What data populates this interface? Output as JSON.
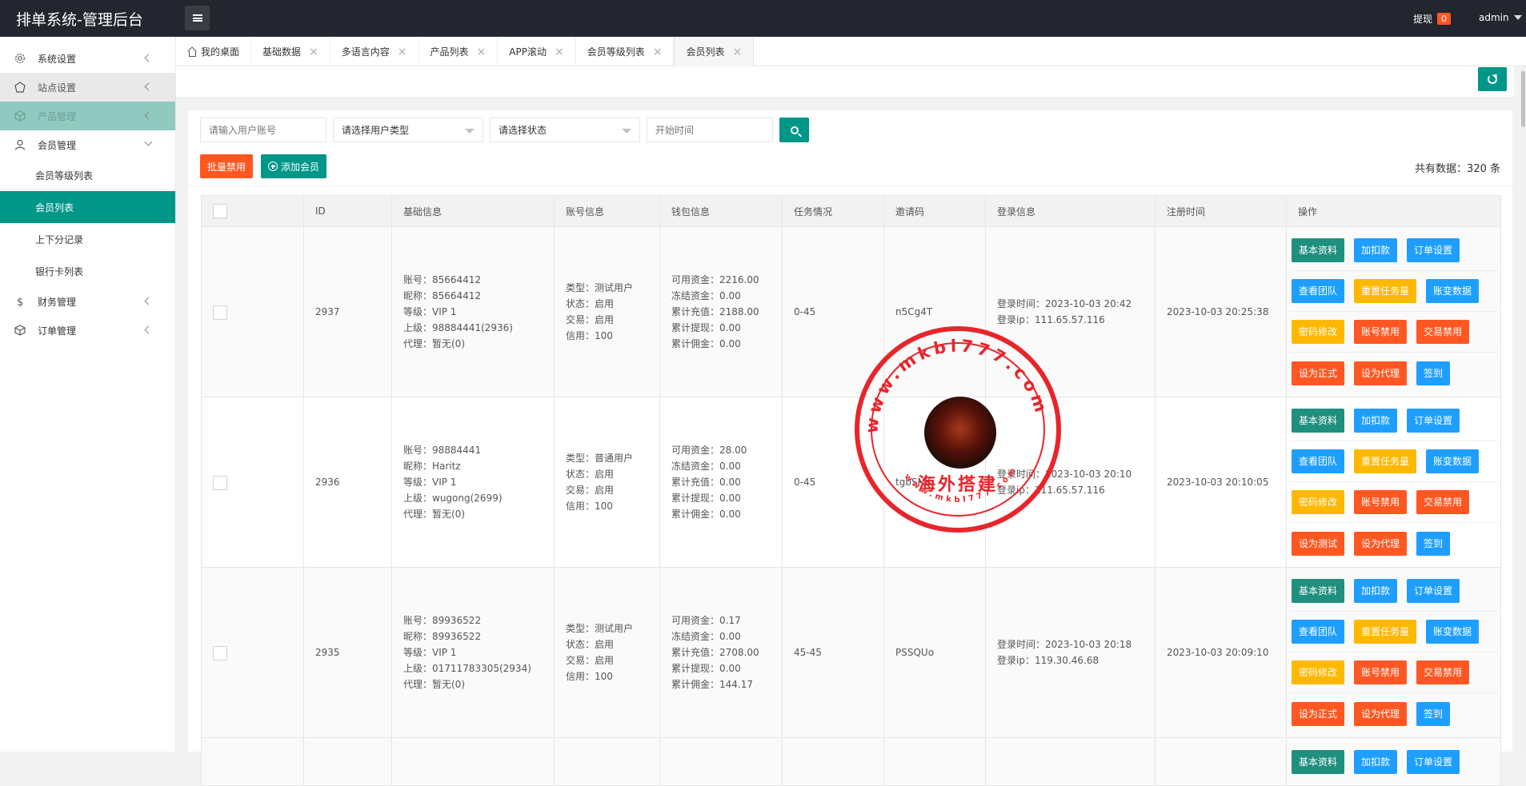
{
  "header": {
    "brand": "排单系统-管理后台",
    "withdraw_label": "提现",
    "withdraw_count": "0",
    "user": "admin"
  },
  "sidebar": {
    "items": [
      {
        "label": "系统设置",
        "icon": "gear-icon"
      },
      {
        "label": "站点设置",
        "icon": "site-icon"
      },
      {
        "label": "产品管理",
        "icon": "box-icon"
      },
      {
        "label": "会员管理",
        "icon": "user-icon"
      },
      {
        "label": "财务管理",
        "icon": "dollar-icon"
      },
      {
        "label": "订单管理",
        "icon": "orders-icon"
      }
    ],
    "sub_items": [
      "会员等级列表",
      "会员列表",
      "上下分记录",
      "银行卡列表"
    ]
  },
  "tabs": [
    {
      "label": "我的桌面"
    },
    {
      "label": "基础数据"
    },
    {
      "label": "多语言内容"
    },
    {
      "label": "产品列表"
    },
    {
      "label": "APP滚动"
    },
    {
      "label": "会员等级列表"
    },
    {
      "label": "会员列表"
    }
  ],
  "filters": {
    "account_placeholder": "请输入用户账号",
    "user_type": "请选择用户类型",
    "status": "请选择状态",
    "start_time_placeholder": "开始时间"
  },
  "actions": {
    "batch_disable": "批量禁用",
    "add_member": "添加会员",
    "total": "共有数据：320 条"
  },
  "table": {
    "columns": [
      "ID",
      "基础信息",
      "账号信息",
      "钱包信息",
      "任务情况",
      "邀请码",
      "登录信息",
      "注册时间",
      "操作"
    ],
    "rows": [
      {
        "id": "2937",
        "basic": [
          "账号：85664412",
          "昵称：85664412",
          "等级：VIP 1",
          "上级：98884441(2936)",
          "代理：暂无(0)"
        ],
        "account": [
          "类型：测试用户",
          "状态：启用",
          "交易：启用",
          "信用：100"
        ],
        "wallet": [
          "可用资金：2216.00",
          "冻结资金：0.00",
          "累计充值：2188.00",
          "累计提现：0.00",
          "累计佣金：0.00"
        ],
        "task": "0-45",
        "invite": "n5Cg4T",
        "login": [
          "登录时间：2023-10-03 20:42",
          "登录ip：111.65.57.116"
        ],
        "register": "2023-10-03 20:25:38",
        "ops": [
          [
            "基本资料",
            "加扣款",
            "订单设置"
          ],
          [
            "查看团队",
            "重置任务量",
            "账变数据"
          ],
          [
            "密码修改",
            "账号禁用",
            "交易禁用"
          ],
          [
            "设为正式",
            "设为代理",
            "签到"
          ]
        ]
      },
      {
        "id": "2936",
        "basic": [
          "账号：98884441",
          "昵称：Haritz",
          "等级：VIP 1",
          "上级：wugong(2699)",
          "代理：暂无(0)"
        ],
        "account": [
          "类型：普通用户",
          "状态：启用",
          "交易：启用",
          "信用：100"
        ],
        "wallet": [
          "可用资金：28.00",
          "冻结资金：0.00",
          "累计充值：0.00",
          "累计提现：0.00",
          "累计佣金：0.00"
        ],
        "task": "0-45",
        "invite": "tgbSNK",
        "login": [
          "登录时间：2023-10-03 20:10",
          "登录ip：111.65.57.116"
        ],
        "register": "2023-10-03 20:10:05",
        "ops": [
          [
            "基本资料",
            "加扣款",
            "订单设置"
          ],
          [
            "查看团队",
            "重置任务量",
            "账变数据"
          ],
          [
            "密码修改",
            "账号禁用",
            "交易禁用"
          ],
          [
            "设为测试",
            "设为代理",
            "签到"
          ]
        ]
      },
      {
        "id": "2935",
        "basic": [
          "账号：89936522",
          "昵称：89936522",
          "等级：VIP 1",
          "上级：01711783305(2934)",
          "代理：暂无(0)"
        ],
        "account": [
          "类型：测试用户",
          "状态：启用",
          "交易：启用",
          "信用：100"
        ],
        "wallet": [
          "可用资金：0.17",
          "冻结资金：0.00",
          "累计充值：2708.00",
          "累计提现：0.00",
          "累计佣金：144.17"
        ],
        "task": "45-45",
        "invite": "PSSQUo",
        "login": [
          "登录时间：2023-10-03 20:18",
          "登录ip：119.30.46.68"
        ],
        "register": "2023-10-03 20:09:10",
        "ops": [
          [
            "基本资料",
            "加扣款",
            "订单设置"
          ],
          [
            "查看团队",
            "重置任务量",
            "账变数据"
          ],
          [
            "密码修改",
            "账号禁用",
            "交易禁用"
          ],
          [
            "设为正式",
            "设为代理",
            "签到"
          ]
        ]
      }
    ],
    "partial_ops": [
      "基本资料",
      "加扣款",
      "订单设置"
    ]
  },
  "watermark": {
    "ring_text": "www.mkbl777.com",
    "inner_text": "www.mkbl777.com",
    "center_text": "海外搭建"
  },
  "colors": {
    "header_bg": "#23262e",
    "primary": "#009688",
    "danger": "#ff5722",
    "info": "#1e9fff",
    "warn": "#ffb800",
    "stamp": "#e8252a"
  }
}
